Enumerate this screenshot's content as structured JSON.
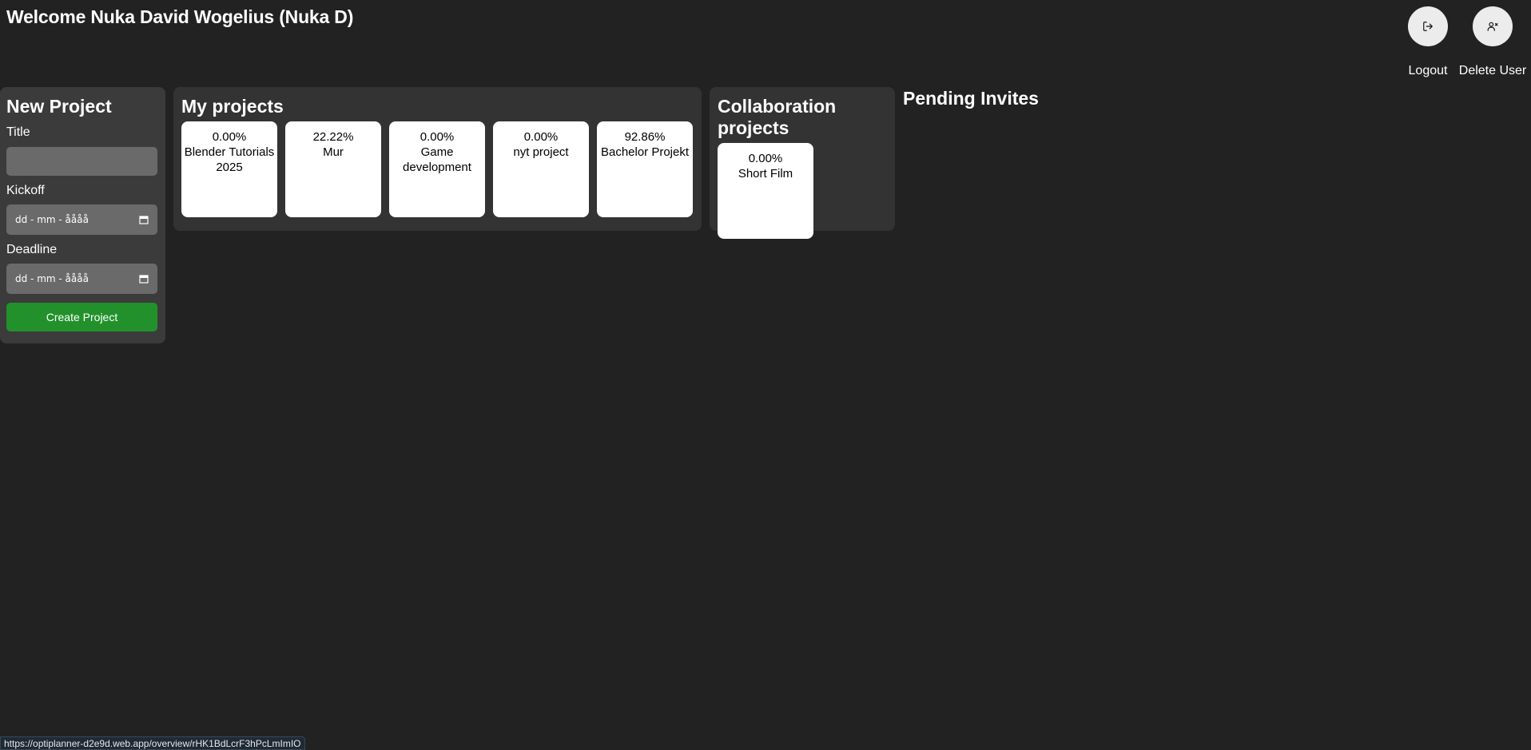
{
  "header": {
    "welcome": "Welcome Nuka David Wogelius (Nuka D)",
    "logout_label": "Logout",
    "delete_user_label": "Delete User"
  },
  "new_project": {
    "title": "New Project",
    "title_label": "Title",
    "title_value": "",
    "kickoff_label": "Kickoff",
    "kickoff_placeholder": "dd - mm - åååå",
    "deadline_label": "Deadline",
    "deadline_placeholder": "dd - mm - åååå",
    "create_label": "Create Project",
    "accent": "#22912b"
  },
  "my_projects": {
    "title": "My projects",
    "items": [
      {
        "progress": "0.00%",
        "name": "Blender Tutorials 2025"
      },
      {
        "progress": "22.22%",
        "name": "Mur"
      },
      {
        "progress": "0.00%",
        "name": "Game development"
      },
      {
        "progress": "0.00%",
        "name": "nyt project"
      },
      {
        "progress": "92.86%",
        "name": "Bachelor Projekt"
      }
    ]
  },
  "collab_projects": {
    "title": "Collaboration projects",
    "items": [
      {
        "progress": "0.00%",
        "name": "Short Film"
      }
    ]
  },
  "pending": {
    "title": "Pending Invites"
  },
  "status_bar": {
    "url": "https://optiplanner-d2e9d.web.app/overview/rHK1BdLcrF3hPcLmImIO"
  }
}
